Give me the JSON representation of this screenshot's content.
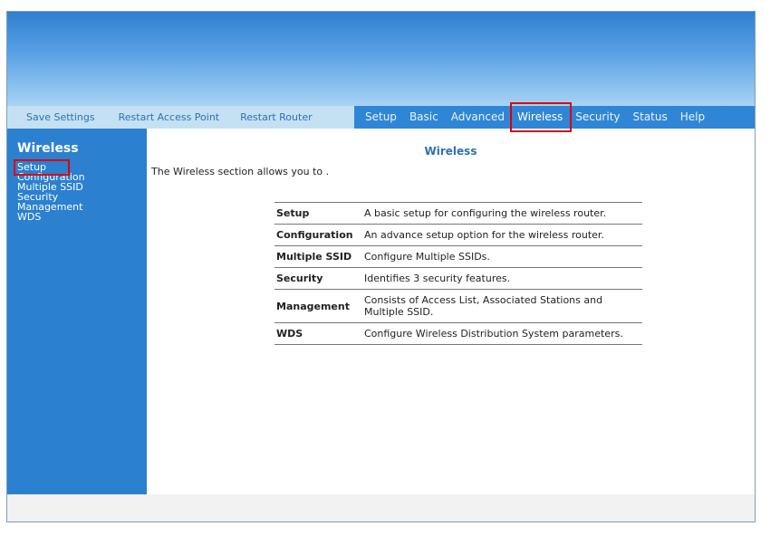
{
  "utility_menu": [
    "Save Settings",
    "Restart Access Point",
    "Restart Router"
  ],
  "tabs": [
    "Setup",
    "Basic",
    "Advanced",
    "Wireless",
    "Security",
    "Status",
    "Help"
  ],
  "active_tab": "Wireless",
  "sidebar": {
    "title": "Wireless",
    "items": [
      "Setup",
      "Configuration",
      "Multiple SSID",
      "Security",
      "Management",
      "WDS"
    ],
    "selected": "Setup"
  },
  "main": {
    "title": "Wireless",
    "intro": "The Wireless section allows you to .",
    "rows": [
      {
        "term": "Setup",
        "desc": "A basic setup for configuring the wireless router."
      },
      {
        "term": "Configuration",
        "desc": "An advance setup option for the wireless router."
      },
      {
        "term": "Multiple SSID",
        "desc": "Configure Multiple SSIDs."
      },
      {
        "term": "Security",
        "desc": "Identifies 3 security features."
      },
      {
        "term": "Management",
        "desc": "Consists of Access List, Associated Stations and Multiple SSID."
      },
      {
        "term": "WDS",
        "desc": "Configure Wireless Distribution System parameters."
      }
    ]
  },
  "colors": {
    "accent": "#2b80d0",
    "highlight": "#e00000",
    "utility_bar": "#c4e1f4"
  }
}
